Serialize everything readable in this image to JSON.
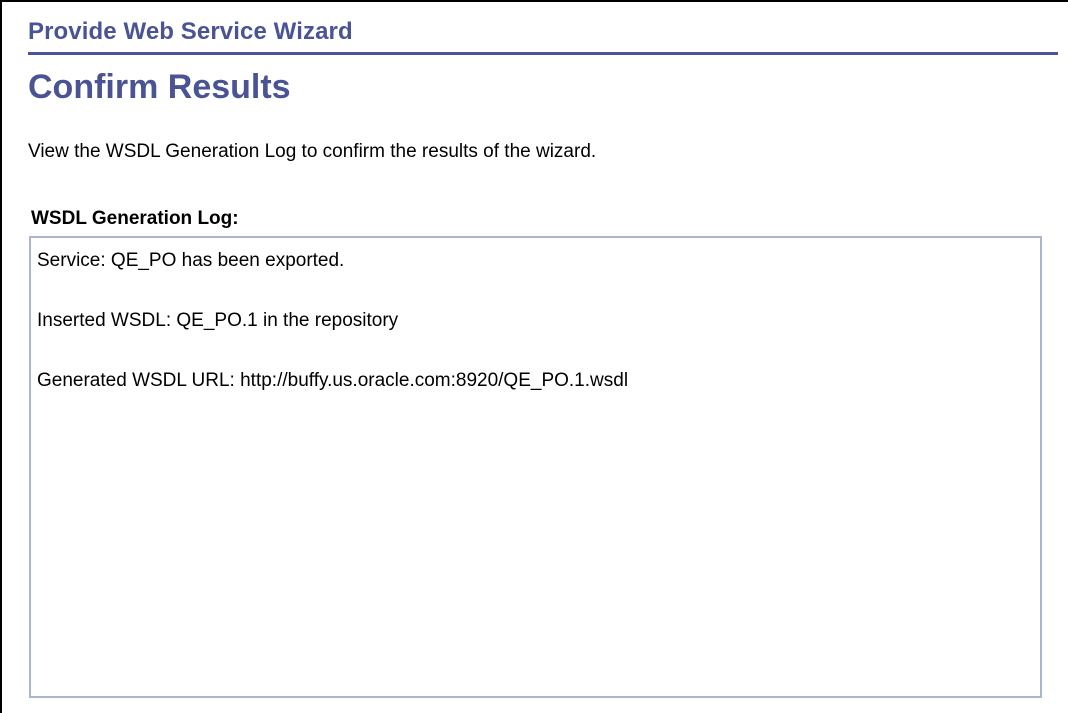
{
  "wizard": {
    "title": "Provide Web Service Wizard"
  },
  "page": {
    "title": "Confirm Results",
    "instructions": "View the WSDL Generation Log to confirm the results of the wizard."
  },
  "log": {
    "label": "WSDL Generation Log:",
    "lines": [
      "Service: QE_PO has been exported.",
      "Inserted WSDL: QE_PO.1 in the repository",
      "Generated WSDL URL: http://buffy.us.oracle.com:8920/QE_PO.1.wsdl"
    ]
  },
  "colors": {
    "heading": "#4a5494",
    "log_border": "#a8b7cb"
  }
}
